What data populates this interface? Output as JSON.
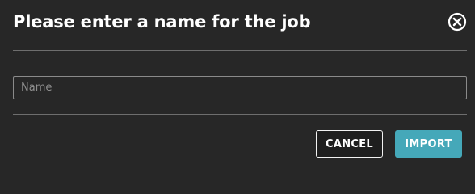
{
  "dialog": {
    "title": "Please enter a name for the job",
    "close_icon": "close-circle-icon",
    "name_input": {
      "value": "",
      "placeholder": "Name"
    },
    "cancel_label": "CANCEL",
    "import_label": "IMPORT"
  },
  "colors": {
    "background": "#272727",
    "text": "#ffffff",
    "divider": "#6e6e6e",
    "accent": "#45a8b9"
  }
}
